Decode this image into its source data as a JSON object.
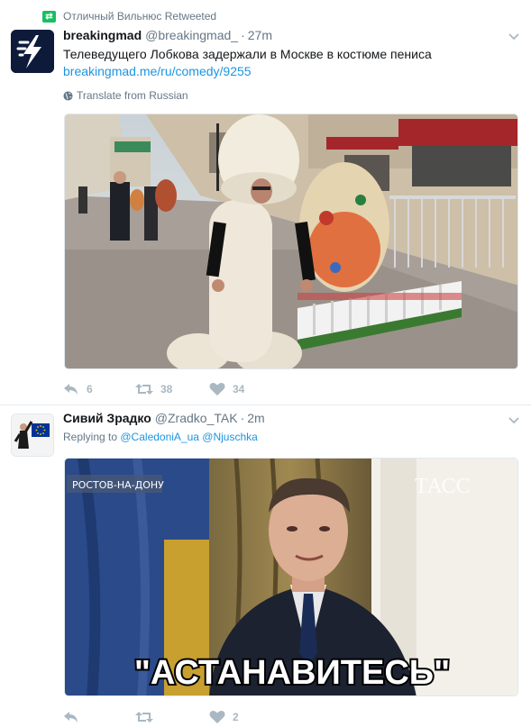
{
  "tweets": [
    {
      "retweet_context": "Отличный Вильнюс Retweeted",
      "fullname": "breakingmad",
      "username": "@breakingmad_",
      "separator": "·",
      "time": "27m",
      "text": "Телеведущего Лобкова задержали в Москве в костюме пениса",
      "link": "breakingmad.me/ru/comedy/9255",
      "translate": "Translate from Russian",
      "actions": {
        "reply": "6",
        "retweet": "38",
        "like": "34"
      }
    },
    {
      "fullname": "Сивий Зрадко",
      "username": "@Zradko_TAK",
      "separator": "·",
      "time": "2m",
      "replying_prefix": "Replying to ",
      "mention1": "@CaledoniA_ua",
      "mention2": "@Njuschka",
      "media_badge": "РОСТОВ-НА-ДОНУ",
      "media_logo": "ТАСС",
      "media_caption": "\"АСТАНАВИТЕСЬ\"",
      "actions": {
        "reply": "",
        "retweet": "",
        "like": "2"
      }
    }
  ],
  "colors": {
    "link": "#1b95e0",
    "muted": "#657786",
    "retweet_green": "#17bf63",
    "action_gray": "#aab8c2"
  },
  "icons": [
    "retweet-badge-icon",
    "lightning-icon",
    "globe-icon",
    "caret-down-icon",
    "reply-icon",
    "retweet-icon",
    "heart-icon"
  ]
}
